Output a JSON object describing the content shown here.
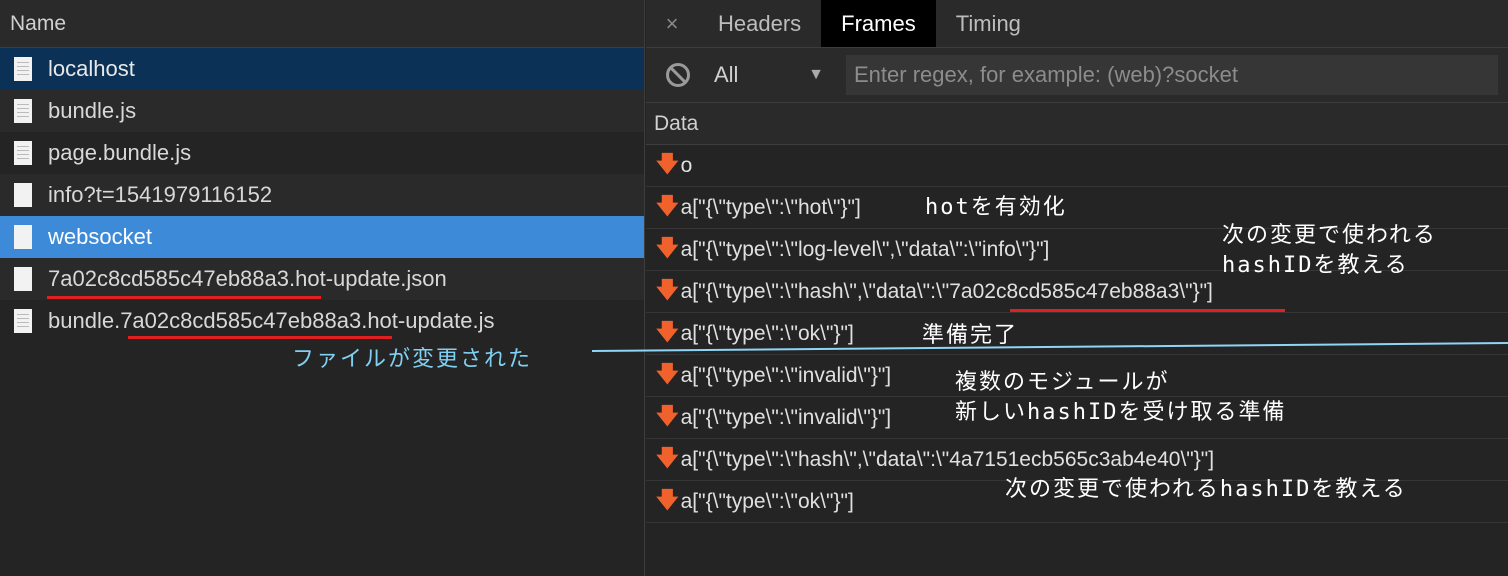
{
  "left": {
    "header": "Name",
    "requests": [
      {
        "name": "localhost"
      },
      {
        "name": "bundle.js"
      },
      {
        "name": "page.bundle.js"
      },
      {
        "name": "info?t=1541979116152"
      },
      {
        "name": "websocket"
      },
      {
        "name": "7a02c8cd585c47eb88a3.hot-update.json"
      },
      {
        "name_prefix": "bundle.",
        "name_hash": "7a02c8cd585c47eb88a3",
        "name_suffix": ".hot-update.js"
      }
    ]
  },
  "right": {
    "close_glyph": "×",
    "tabs": [
      "Headers",
      "Frames",
      "Timing"
    ],
    "active_tab": "Frames",
    "filter": {
      "selected": "All",
      "placeholder": "Enter regex, for example: (web)?socket"
    },
    "data_header": "Data",
    "frames": [
      "o",
      "a[\"{\\\"type\\\":\\\"hot\\\"}\"]",
      "a[\"{\\\"type\\\":\\\"log-level\\\",\\\"data\\\":\\\"info\\\"}\"]",
      "a[\"{\\\"type\\\":\\\"hash\\\",\\\"data\\\":\\\"7a02c8cd585c47eb88a3\\\"}\"]",
      "a[\"{\\\"type\\\":\\\"ok\\\"}\"]",
      "a[\"{\\\"type\\\":\\\"invalid\\\"}\"]",
      "a[\"{\\\"type\\\":\\\"invalid\\\"}\"]",
      "a[\"{\\\"type\\\":\\\"hash\\\",\\\"data\\\":\\\"4a7151ecb565c3ab4e40\\\"}\"]",
      "a[\"{\\\"type\\\":\\\"ok\\\"}\"]"
    ]
  },
  "annotations": {
    "hot": "hotを有効化",
    "hash1_line1": "次の変更で使われる",
    "hash1_line2": "hashIDを教える",
    "ok": "準備完了",
    "invalid_line1": "複数のモジュールが",
    "invalid_line2": "新しいhashIDを受け取る準備",
    "hash2": "次の変更で使われるhashIDを教える",
    "file_changed": "ファイルが変更された"
  },
  "colors": {
    "accent_selected": "#3d8ad8",
    "selected_dim": "#0b3256",
    "arrow_incoming": "#f0612c",
    "underline": "#e02020",
    "annotation_blue": "#7fd0f2"
  }
}
